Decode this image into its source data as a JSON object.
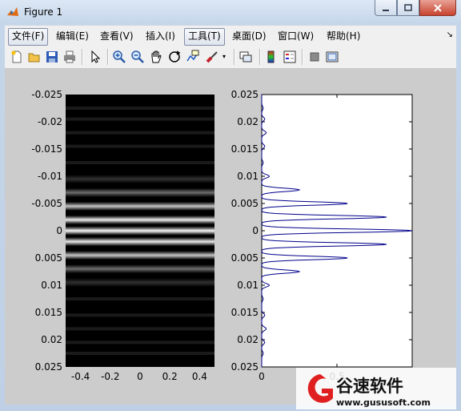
{
  "window": {
    "title": "Figure 1"
  },
  "menu": [
    "文件(F)",
    "编辑(E)",
    "查看(V)",
    "插入(I)",
    "工具(T)",
    "桌面(D)",
    "窗口(W)",
    "帮助(H)"
  ],
  "toolbar_icons": [
    "new-figure-icon",
    "open-file-icon",
    "save-icon",
    "print-icon",
    "pointer-icon",
    "zoom-in-icon",
    "zoom-out-icon",
    "pan-icon",
    "rotate-3d-icon",
    "data-cursor-icon",
    "brush-icon",
    "link-plot-icon",
    "colorbar-icon",
    "legend-icon",
    "hide-plot-tools-icon",
    "show-plot-tools-icon"
  ],
  "chart_data": [
    {
      "type": "heatmap",
      "title": "",
      "colormap": "gray",
      "x_ticks": [
        "-0.4",
        "-0.2",
        "0",
        "0.2",
        "0.4"
      ],
      "y_ticks": [
        "-0.025",
        "-0.02",
        "-0.015",
        "-0.01",
        "-0.005",
        "0",
        "0.005",
        "0.01",
        "0.015",
        "0.02",
        "0.025"
      ],
      "xlim": [
        -0.5,
        0.5
      ],
      "ylim": [
        -0.025,
        0.025
      ],
      "y_reversed": true,
      "description_of_values": "intensity constant along x, varying along y",
      "y": [
        -0.0095,
        -0.007,
        -0.0045,
        -0.002,
        0,
        0.002,
        0.0045,
        0.007,
        0.0095
      ],
      "intensity": [
        0.2,
        0.45,
        0.8,
        0.95,
        1.0,
        0.95,
        0.8,
        0.45,
        0.2
      ]
    },
    {
      "type": "line",
      "title": "",
      "x_ticks": [
        "0",
        "0.5"
      ],
      "y_ticks": [
        "0.025",
        "0.02",
        "0.015",
        "0.01",
        "0.005",
        "0",
        "0.005",
        "0.01",
        "0.015",
        "0.02",
        "0.025"
      ],
      "xlim": [
        0,
        1
      ],
      "ylim": [
        -0.025,
        0.025
      ],
      "y_reversed": true,
      "color": "#00008b",
      "peaks": {
        "y": [
          -0.0225,
          -0.0205,
          -0.018,
          -0.0155,
          -0.0125,
          -0.01,
          -0.0075,
          -0.005,
          -0.0025,
          0,
          0.0025,
          0.005,
          0.0075,
          0.01,
          0.0125,
          0.0155,
          0.018,
          0.0205,
          0.0225
        ],
        "x": [
          0.01,
          0.02,
          0.03,
          0.02,
          0.01,
          0.05,
          0.25,
          0.57,
          0.83,
          1.0,
          0.83,
          0.57,
          0.25,
          0.05,
          0.01,
          0.02,
          0.03,
          0.02,
          0.01
        ]
      }
    }
  ],
  "watermark": {
    "brand": "谷速软件",
    "url": "www.gususoft.com",
    "accent": "#e02020"
  }
}
